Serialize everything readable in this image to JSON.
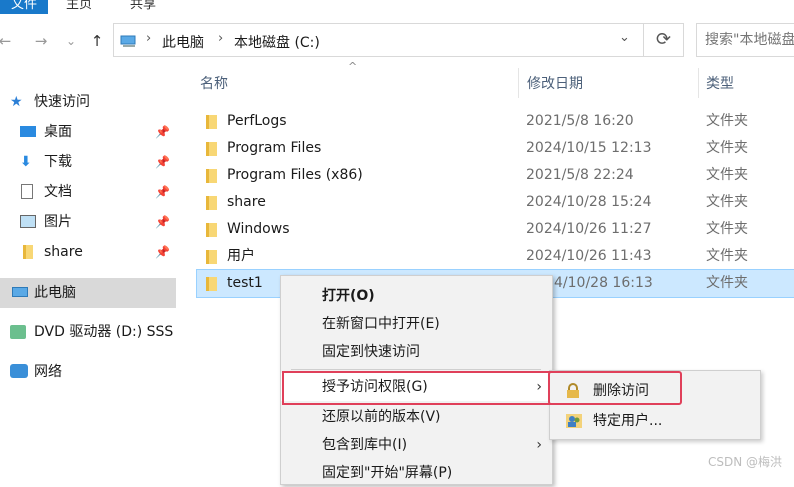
{
  "ribbon": {
    "tabs": [
      "文件",
      "主页",
      "共享"
    ]
  },
  "nav": {
    "back": "←",
    "forward": "→",
    "recent": "⌄",
    "up": "↑",
    "breadcrumb": [
      "此电脑",
      "本地磁盘 (C:)"
    ],
    "search_placeholder": "搜索\"本地磁盘"
  },
  "sidebar": {
    "items": [
      {
        "label": "快速访问",
        "icon": "star-icon"
      },
      {
        "label": "桌面",
        "icon": "desktop-icon",
        "pinned": true
      },
      {
        "label": "下载",
        "icon": "download-icon",
        "pinned": true
      },
      {
        "label": "文档",
        "icon": "document-icon",
        "pinned": true
      },
      {
        "label": "图片",
        "icon": "picture-icon",
        "pinned": true
      },
      {
        "label": "share",
        "icon": "folder-icon",
        "pinned": true
      },
      {
        "label": "此电脑",
        "icon": "computer-icon",
        "selected": true
      },
      {
        "label": "DVD 驱动器 (D:) SSS",
        "icon": "dvd-icon"
      },
      {
        "label": "网络",
        "icon": "network-icon"
      }
    ]
  },
  "columns": {
    "name": "名称",
    "date": "修改日期",
    "type": "类型"
  },
  "files": [
    {
      "name": "PerfLogs",
      "date": "2021/5/8 16:20",
      "type": "文件夹"
    },
    {
      "name": "Program Files",
      "date": "2024/10/15 12:13",
      "type": "文件夹"
    },
    {
      "name": "Program Files (x86)",
      "date": "2021/5/8 22:24",
      "type": "文件夹"
    },
    {
      "name": "share",
      "date": "2024/10/28 15:24",
      "type": "文件夹"
    },
    {
      "name": "Windows",
      "date": "2024/10/26 11:27",
      "type": "文件夹"
    },
    {
      "name": "用户",
      "date": "2024/10/26 11:43",
      "type": "文件夹"
    },
    {
      "name": "test1",
      "date": "4/10/28 16:13",
      "type": "文件夹",
      "selected": true
    }
  ],
  "context_menu": {
    "items": [
      {
        "label": "打开(O)",
        "bold": true
      },
      {
        "label": "在新窗口中打开(E)"
      },
      {
        "label": "固定到快速访问"
      },
      {
        "label": "授予访问权限(G)",
        "submenu": true,
        "hover": true
      },
      {
        "label": "还原以前的版本(V)"
      },
      {
        "label": "包含到库中(I)",
        "submenu": true
      },
      {
        "label": "固定到\"开始\"屏幕(P)"
      }
    ],
    "submenu_items": [
      {
        "label": "删除访问",
        "icon": "lock-icon"
      },
      {
        "label": "特定用户...",
        "icon": "users-icon"
      }
    ]
  },
  "watermark": "CSDN @梅洪",
  "colors": {
    "accent": "#1979ca",
    "selection": "#cce8ff",
    "highlight_border": "#e0405a"
  }
}
